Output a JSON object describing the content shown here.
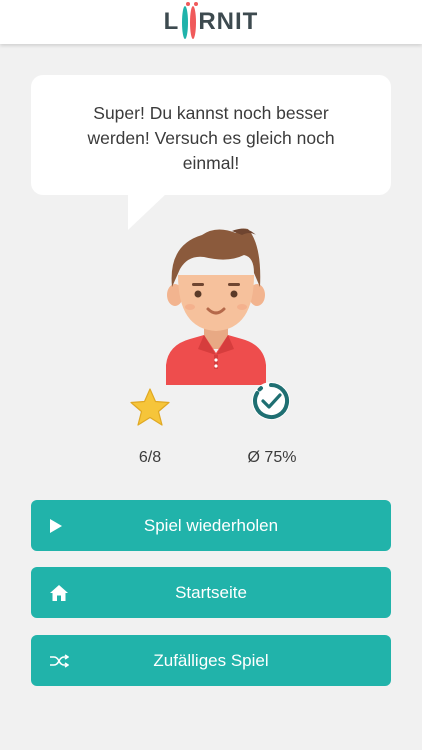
{
  "header": {
    "logo_letters": {
      "l": "L",
      "rest": "RNIT"
    }
  },
  "feedback": {
    "message": "Super! Du kannst noch besser werden! Versuch es gleich noch einmal!"
  },
  "stats": {
    "stars": "6/8",
    "average": "Ø 75%",
    "icons": {
      "stars": "star-icon",
      "average": "check-circle-icon"
    }
  },
  "actions": {
    "replay_label": "Spiel wiederholen",
    "home_label": "Startseite",
    "random_label": "Zufälliges Spiel"
  },
  "colors": {
    "accent": "#21b3aa",
    "logo_red": "#f05a5b",
    "background": "#f1f1f1",
    "star": "#f6c53a"
  }
}
